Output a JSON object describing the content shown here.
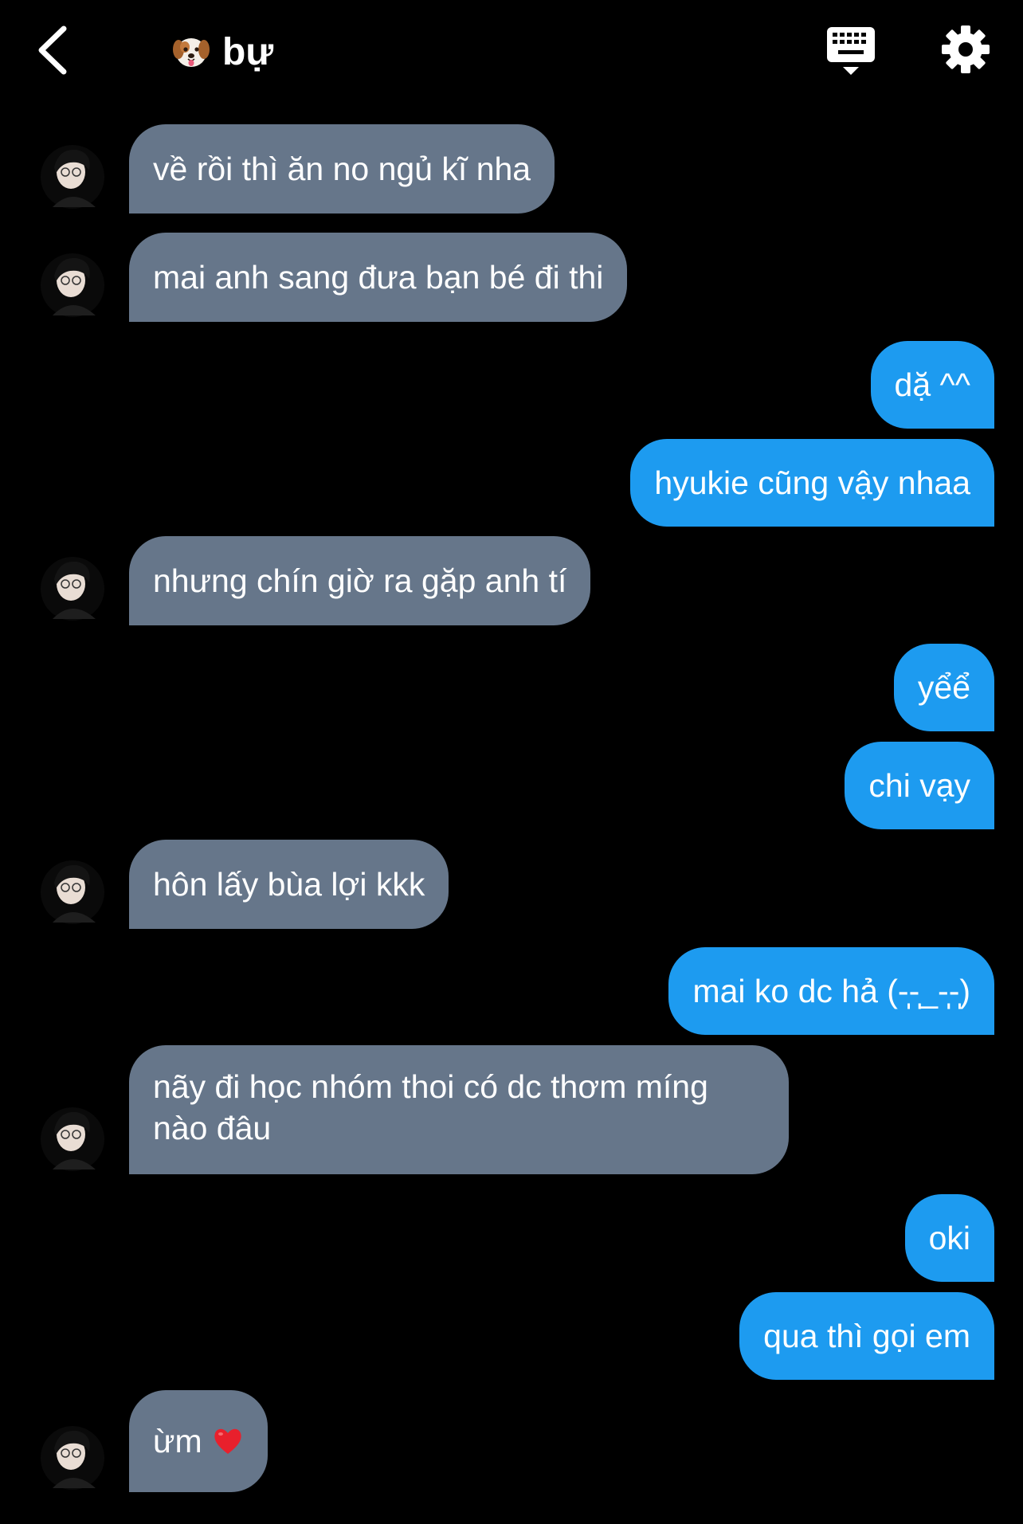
{
  "header": {
    "title": "bự",
    "title_emoji": "dog-face-emoji",
    "back_icon": "chevron-left-icon",
    "keyboard_icon": "keyboard-icon",
    "settings_icon": "gear-icon"
  },
  "colors": {
    "background": "#000000",
    "incoming_bubble": "#66768a",
    "outgoing_bubble": "#1d9bf0",
    "text": "#ffffff"
  },
  "messages": [
    {
      "dir": "in",
      "text": "về rồi thì ăn no ngủ kĩ nha"
    },
    {
      "dir": "in",
      "text": "mai anh sang đưa bạn bé đi thi"
    },
    {
      "dir": "out",
      "text": "dặ ^^"
    },
    {
      "dir": "out",
      "text": "hyukie cũng vậy nhaa"
    },
    {
      "dir": "in",
      "text": "nhưng chín giờ ra gặp anh tí"
    },
    {
      "dir": "out",
      "text": "yểể"
    },
    {
      "dir": "out",
      "text": "chi vạy"
    },
    {
      "dir": "in",
      "text": "hôn lấy bùa lợi kkk"
    },
    {
      "dir": "out",
      "text": "mai ko dc hả (-̩̩̩-̩̩̩_-̩̩̩-̩̩̩)"
    },
    {
      "dir": "in",
      "text": "nãy đi học nhóm thoi có dc thơm míng nào đâu"
    },
    {
      "dir": "out",
      "text": "oki"
    },
    {
      "dir": "out",
      "text": "qua thì gọi em"
    },
    {
      "dir": "in",
      "text": "ừm",
      "emoji": "red-heart-emoji"
    }
  ]
}
